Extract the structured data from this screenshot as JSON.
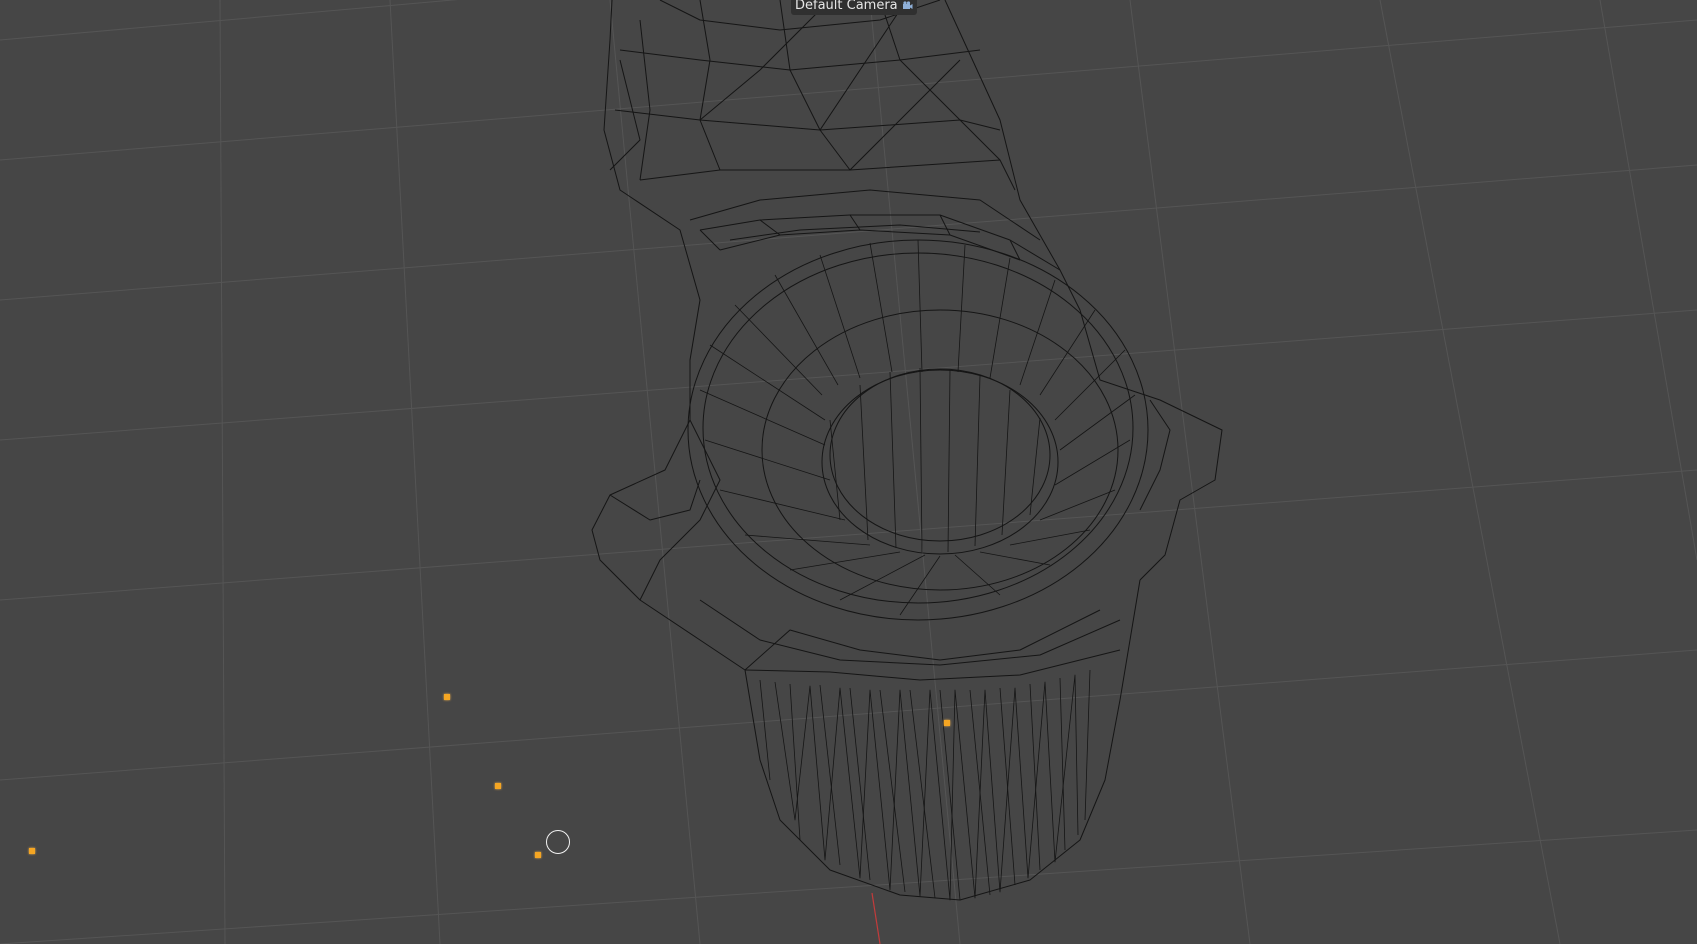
{
  "viewport": {
    "mode": "wireframe",
    "background": "#464646",
    "grid_color": "#555555",
    "wire_color": "#151515",
    "x_axis_color": "#c23b3b"
  },
  "camera_label": {
    "text": "Default Camera",
    "icon": "camera-icon"
  },
  "markers": {
    "color": "#f5a623",
    "count": 5
  },
  "cursor": {
    "icon": "3d-cursor-icon"
  }
}
